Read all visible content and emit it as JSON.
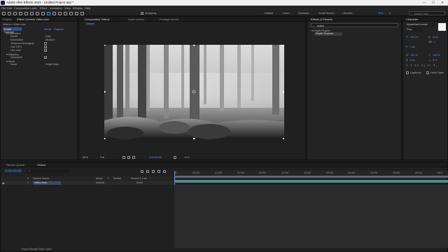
{
  "window": {
    "title": "Adobe After Effects 2022 - Untitled Project.aep *",
    "min": "—",
    "max": "☐",
    "close": "✕"
  },
  "menu": [
    "File",
    "Edit",
    "Composition",
    "Layer",
    "Effect",
    "Animation",
    "View",
    "Window",
    "Help"
  ],
  "toolbar": {
    "snapping": "Snapping",
    "workspaces": [
      "Default",
      "Learn",
      "Standard",
      "Small Screen",
      "Libraries",
      "Text",
      "»"
    ],
    "active_workspace": "Text",
    "search_placeholder": "Search Help"
  },
  "left_panel": {
    "tabs": [
      "Project",
      "Effect Controls Video.mov"
    ],
    "header": "Videos • Video.mov",
    "effect": {
      "name": "Depth Scanner",
      "reset": "Reset",
      "register": "Register"
    },
    "groups": [
      {
        "label": "▾ Estimation",
        "indent": 0
      },
      {
        "label": "Model",
        "value": "Fast",
        "indent": 1
      },
      {
        "label": "Resolution",
        "value": "Medium",
        "indent": 1
      },
      {
        "label": "Temporal Averaging",
        "indent": 1,
        "checkbox": false
      },
      {
        "label": "Use GPU",
        "indent": 1,
        "checkbox": true
      },
      {
        "label": "Use Half",
        "indent": 1,
        "checkbox": true
      },
      {
        "label": "▾ Mapping",
        "indent": 0
      },
      {
        "label": "Normalize",
        "indent": 1,
        "checkbox": true
      },
      {
        "label": "▾ Mode",
        "indent": 0
      },
      {
        "label": "Mode",
        "value": "Depth Map",
        "indent": 1
      }
    ]
  },
  "composition": {
    "tabs": [
      "Composition Videos",
      "Layer (none)",
      "Footage (none)"
    ],
    "comp_tab": "Videos",
    "zoom": "89%",
    "resolution": "Full",
    "timecode": "0:00:00:00",
    "exposure": "+0.0"
  },
  "effects_presets": {
    "tab": "Effects & Presets",
    "search_value": "scann",
    "category": "▾ Depth Plugins",
    "item": "Depth Scanner"
  },
  "character": {
    "tab": "Character",
    "font": "MyriadVariConcept",
    "style": "Reg...",
    "size": "100 px",
    "leading": "Auto",
    "tracking": "0",
    "stroke": "1 px",
    "vscale": "100 %",
    "hscale": "100 %",
    "baseline": "0 px",
    "tsume": "0 %",
    "ligatures": "Ligatures",
    "hindi_digits": "Hindi Digits"
  },
  "timeline": {
    "tabs": [
      "Render Queue",
      "Videos"
    ],
    "timecode": "0:00:00:00",
    "search_placeholder": "⌕",
    "columns": [
      "#",
      "Source Name",
      "Mode",
      "T",
      "TrkMat",
      "Parent & Link"
    ],
    "layer": {
      "index": "1",
      "name": "Video.mov",
      "mode": "Normal",
      "parent": "None"
    },
    "ruler": [
      "0f",
      "00:15f",
      "01:00f",
      "01:15f",
      "02:00f",
      "02:15f",
      "03:00f",
      "03:15f",
      "04:00f",
      "04:15f",
      "05:00f",
      "05:15f",
      "06:0"
    ],
    "footer": "Frame Render Time: 14ms"
  },
  "colors": {
    "accent": "#4a9cff",
    "panel": "#232323",
    "track": "#4e8a91"
  }
}
